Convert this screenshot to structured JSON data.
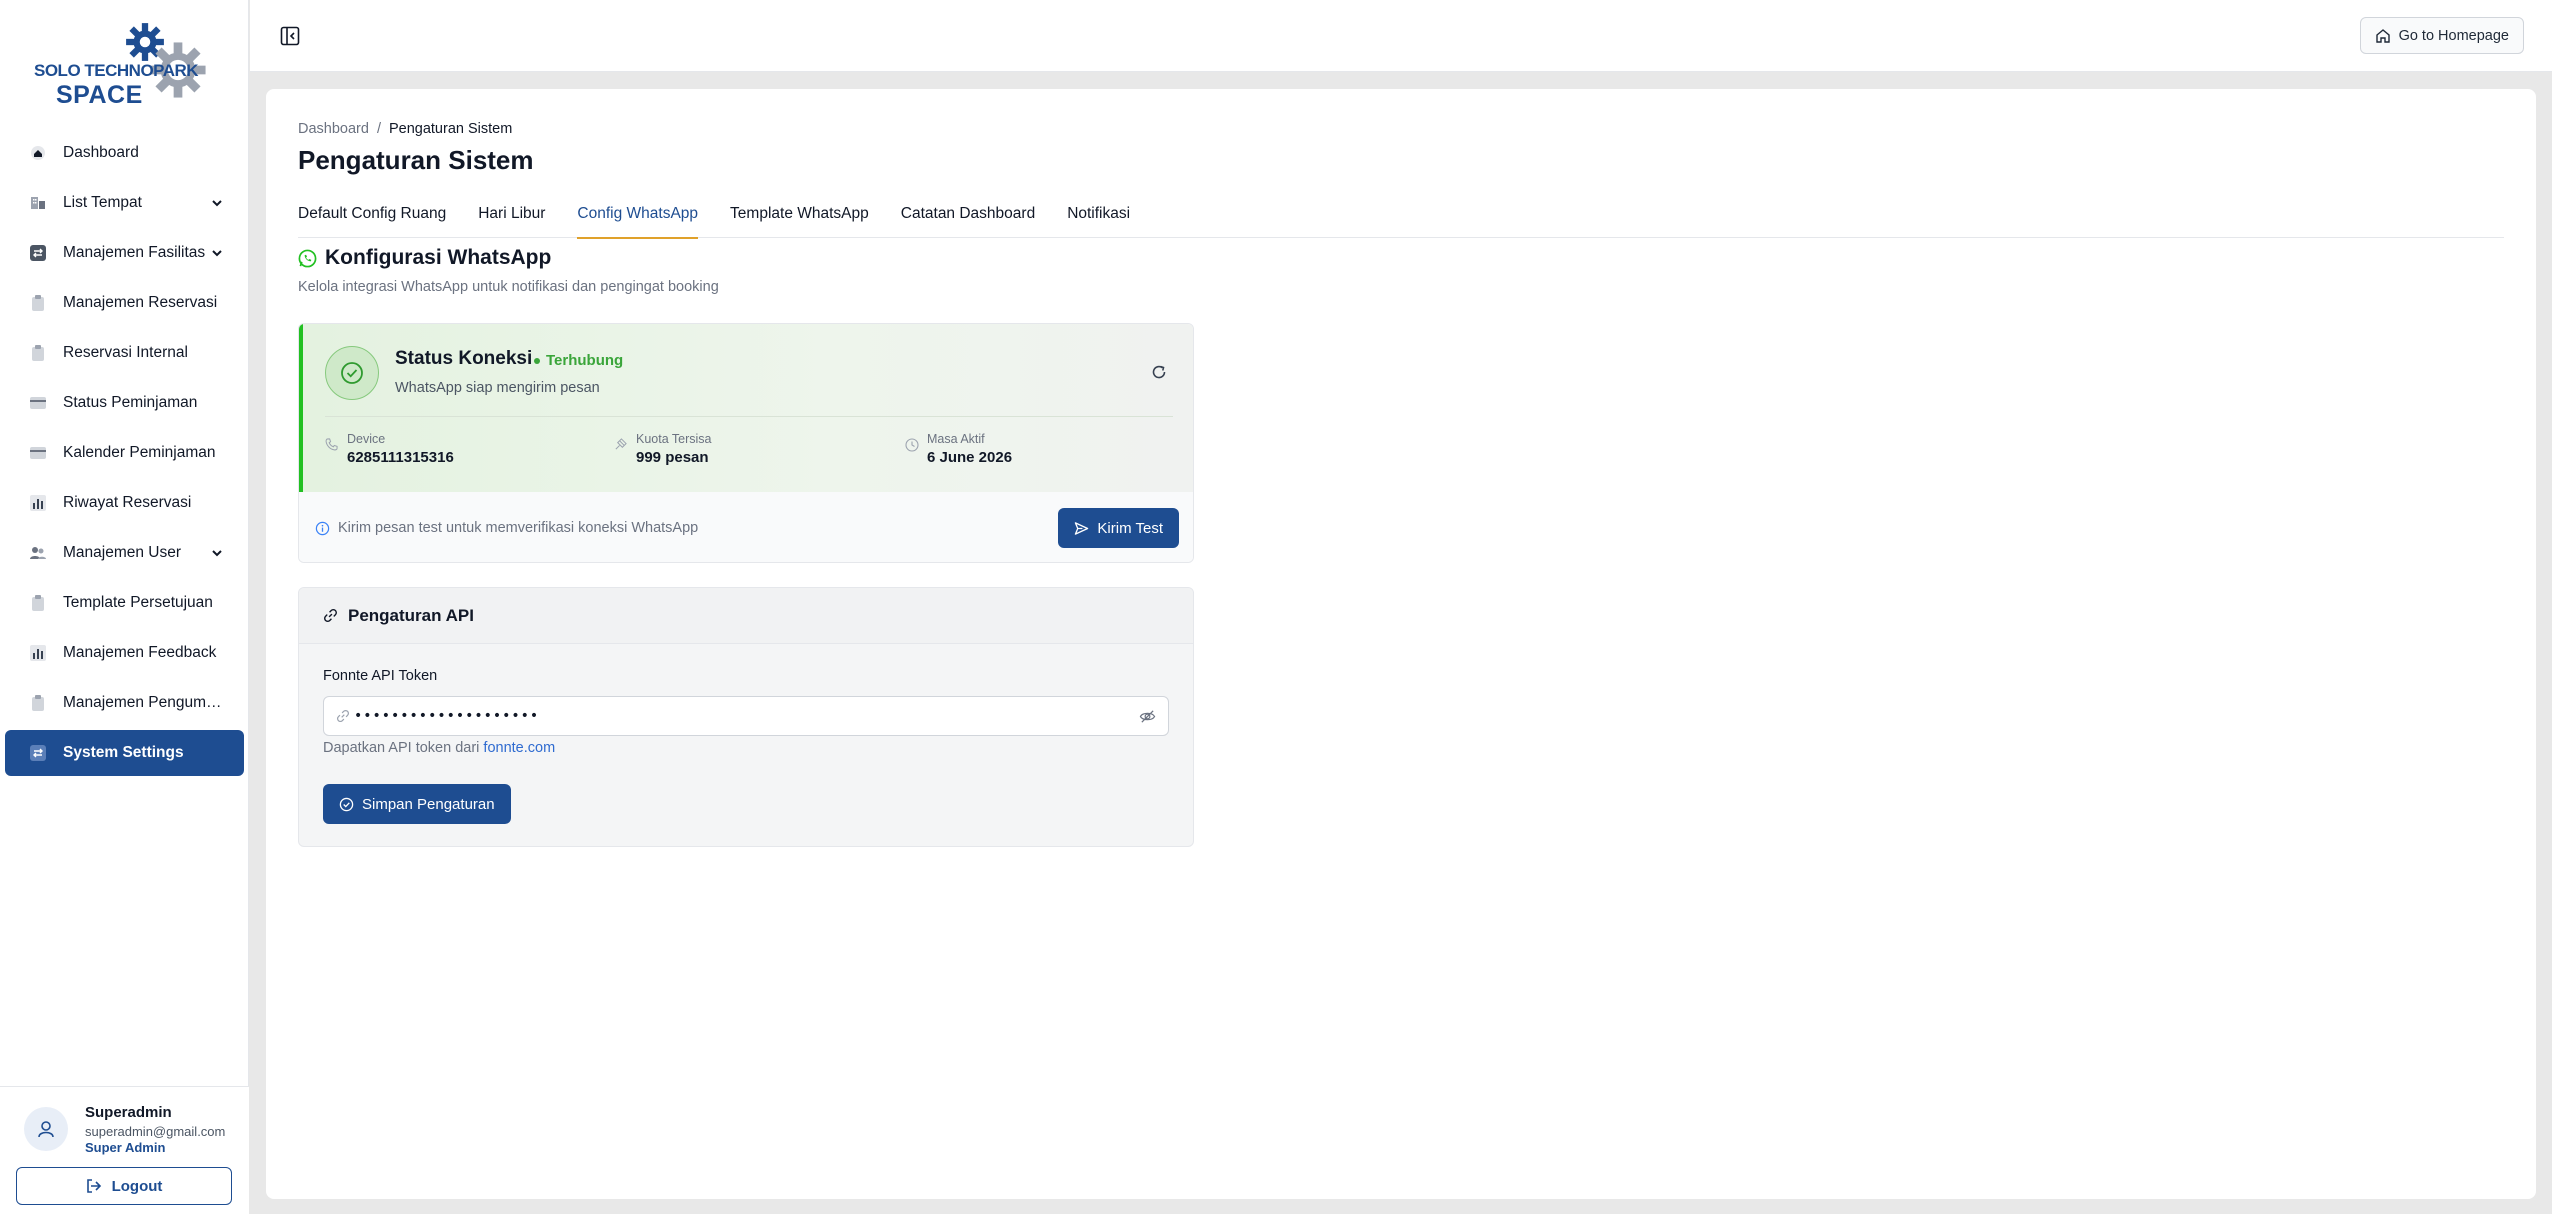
{
  "brand": {
    "line1": "SOLO TECHNOPARK",
    "line2": "SPACE",
    "color": "#1e4d91"
  },
  "sidebar": {
    "items": [
      {
        "label": "Dashboard",
        "icon": "home-icon"
      },
      {
        "label": "List Tempat",
        "icon": "building-icon",
        "expandable": true
      },
      {
        "label": "Manajemen Fasilitas",
        "icon": "swap-icon",
        "expandable": true
      },
      {
        "label": "Manajemen Reservasi",
        "icon": "clipboard-icon"
      },
      {
        "label": "Reservasi Internal",
        "icon": "clipboard-icon"
      },
      {
        "label": "Status Peminjaman",
        "icon": "card-icon"
      },
      {
        "label": "Kalender Peminjaman",
        "icon": "card-icon"
      },
      {
        "label": "Riwayat Reservasi",
        "icon": "chart-icon"
      },
      {
        "label": "Manajemen User",
        "icon": "users-icon",
        "expandable": true
      },
      {
        "label": "Template Persetujuan",
        "icon": "clipboard-icon"
      },
      {
        "label": "Manajemen Feedback",
        "icon": "chart-icon"
      },
      {
        "label": "Manajemen Pengumu...",
        "icon": "clipboard-icon"
      },
      {
        "label": "System Settings",
        "icon": "swap-icon",
        "active": true
      }
    ]
  },
  "user": {
    "name": "Superadmin",
    "email": "superadmin@gmail.com",
    "role": "Super Admin",
    "logout_label": "Logout"
  },
  "topbar": {
    "home_label": "Go to Homepage"
  },
  "breadcrumb": {
    "root": "Dashboard",
    "separator": "/",
    "current": "Pengaturan Sistem"
  },
  "page_title": "Pengaturan Sistem",
  "tabs": [
    {
      "label": "Default Config Ruang"
    },
    {
      "label": "Hari Libur"
    },
    {
      "label": "Config WhatsApp",
      "active": true
    },
    {
      "label": "Template WhatsApp"
    },
    {
      "label": "Catatan Dashboard"
    },
    {
      "label": "Notifikasi"
    }
  ],
  "whatsapp": {
    "title": "Konfigurasi WhatsApp",
    "subtitle": "Kelola integrasi WhatsApp untuk notifikasi dan pengingat booking",
    "status": {
      "label": "Status Koneksi",
      "badge": "Terhubung",
      "message": "WhatsApp siap mengirim pesan",
      "device_label": "Device",
      "device_value": "6285111315316",
      "quota_label": "Kuota Tersisa",
      "quota_value": "999 pesan",
      "active_label": "Masa Aktif",
      "active_value": "6 June 2026"
    },
    "test": {
      "info": "Kirim pesan test untuk memverifikasi koneksi WhatsApp",
      "button": "Kirim Test"
    }
  },
  "api": {
    "title": "Pengaturan API",
    "token_label": "Fonnte API Token",
    "token_value": "••••••••••••••••••••",
    "hint_prefix": "Dapatkan API token dari",
    "hint_link": "fonnte.com",
    "save_label": "Simpan Pengaturan"
  },
  "colors": {
    "primary": "#1e4d91",
    "success": "#22c022",
    "tab_indicator": "#e0a12a",
    "link": "#2f6bd0"
  }
}
